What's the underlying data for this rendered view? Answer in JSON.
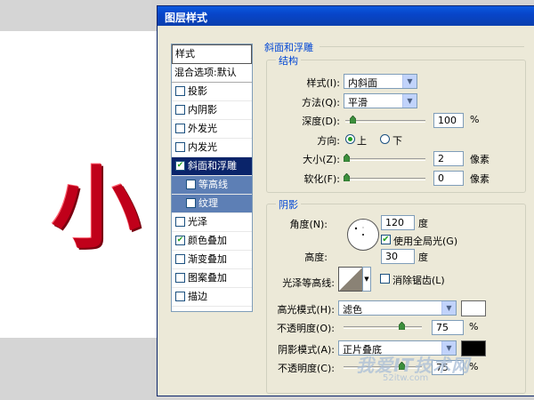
{
  "dialog_title": "图层样式",
  "canvas_char": "小",
  "style_list": {
    "header": "样式",
    "blend": "混合选项:默认",
    "items": [
      {
        "label": "投影",
        "checked": false
      },
      {
        "label": "内阴影",
        "checked": false
      },
      {
        "label": "外发光",
        "checked": false
      },
      {
        "label": "内发光",
        "checked": false
      },
      {
        "label": "斜面和浮雕",
        "checked": true
      },
      {
        "label": "等高线",
        "checked": false
      },
      {
        "label": "纹理",
        "checked": false
      },
      {
        "label": "光泽",
        "checked": false
      },
      {
        "label": "颜色叠加",
        "checked": true
      },
      {
        "label": "渐变叠加",
        "checked": false
      },
      {
        "label": "图案叠加",
        "checked": false
      },
      {
        "label": "描边",
        "checked": false
      }
    ],
    "check_mark": "✔"
  },
  "bevel": {
    "section_title": "斜面和浮雕",
    "structure_title": "结构",
    "style_label": "样式(I):",
    "style_value": "内斜面",
    "method_label": "方法(Q):",
    "method_value": "平滑",
    "depth_label": "深度(D):",
    "depth_value": "100",
    "depth_unit": "%",
    "depth_level": 0.1,
    "direction_label": "方向:",
    "dir_up": "上",
    "dir_down": "下",
    "size_label": "大小(Z):",
    "size_value": "2",
    "size_unit": "像素",
    "soften_label": "软化(F):",
    "soften_value": "0",
    "soften_unit": "像素"
  },
  "shading": {
    "title": "阴影",
    "angle_label": "角度(N):",
    "angle_value": "120",
    "angle_unit": "度",
    "global_light_label": "使用全局光(G)",
    "global_light": true,
    "altitude_label": "高度:",
    "altitude_value": "30",
    "altitude_unit": "度",
    "gloss_label": "光泽等高线:",
    "antialias_label": "消除锯齿(L)",
    "highlight_label": "高光模式(H):",
    "highlight_value": "滤色",
    "highlight_color": "#ffffff",
    "opacity1_label": "不透明度(O):",
    "opacity1_value": "75",
    "opacity1_unit": "%",
    "shadow_label": "阴影模式(A):",
    "shadow_value": "正片叠底",
    "shadow_color": "#000000",
    "opacity2_label": "不透明度(C):",
    "opacity2_value": "75",
    "opacity2_unit": "%"
  },
  "watermark": "我爱IT技术网",
  "watermark_url": "52itw.com"
}
